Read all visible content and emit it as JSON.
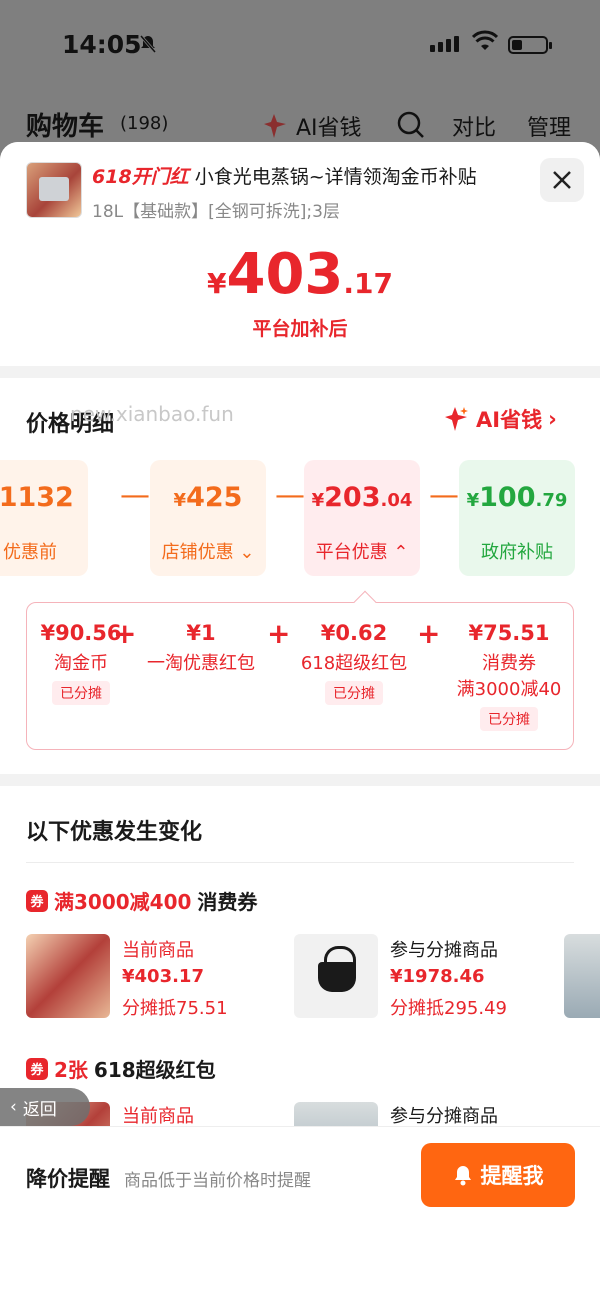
{
  "status": {
    "time": "14:05"
  },
  "background": {
    "cart_title": "购物车",
    "cart_count": "(198)",
    "ai_save": "AI省钱",
    "compare": "对比",
    "manage": "管理"
  },
  "product": {
    "tag": "618开门红",
    "title": "小食光电蒸锅~详情领淘金币补贴",
    "spec": "18L【基础款】[全钢可拆洗];3层",
    "price_currency": "¥",
    "price_int": "403",
    "price_dec": ".17",
    "price_caption": "平台加补后"
  },
  "breakdown": {
    "title": "价格明细",
    "watermark": "new.xianbao.fun",
    "ai_link": "AI省钱",
    "boxes": [
      {
        "cur": "¥",
        "int": "1132",
        "dec": "",
        "label": "优惠前"
      },
      {
        "cur": "¥",
        "int": "425",
        "dec": "",
        "label": "店铺优惠"
      },
      {
        "cur": "¥",
        "int": "203",
        "dec": ".04",
        "label": "平台优惠"
      },
      {
        "cur": "¥",
        "int": "100",
        "dec": ".79",
        "label": "政府补贴"
      }
    ],
    "operator": "—",
    "details": [
      {
        "amount": "¥90.56",
        "label": "淘金币",
        "extra": "",
        "share": "已分摊"
      },
      {
        "amount": "¥1",
        "label": "一淘优惠红包",
        "extra": "",
        "share": ""
      },
      {
        "amount": "¥0.62",
        "label": "618超级红包",
        "extra": "",
        "share": "已分摊"
      },
      {
        "amount": "¥75.51",
        "label": "消费券",
        "extra": "满3000减40",
        "share": "已分摊"
      }
    ],
    "plus": "+"
  },
  "changes": {
    "title": "以下优惠发生变化",
    "coupon1": {
      "icon": "券",
      "highlight": "满3000减400",
      "rest": "消费券"
    },
    "items1": [
      {
        "head": "当前商品",
        "price": "¥403.17",
        "note": "分摊抵75.51"
      },
      {
        "head": "参与分摊商品",
        "price": "¥1978.46",
        "note": "分摊抵295.49"
      }
    ],
    "coupon2": {
      "icon": "券",
      "highlight": "2张",
      "rest": "618超级红包"
    },
    "items2": [
      {
        "head": "当前商品"
      },
      {
        "head": "参与分摊商品"
      }
    ]
  },
  "remind": {
    "title": "降价提醒",
    "desc": "商品低于当前价格时提醒",
    "button": "提醒我"
  },
  "back": "返回",
  "colors": {
    "red": "#e8262c",
    "orange": "#f36b1c",
    "green": "#23a73f",
    "button": "#ff6611"
  }
}
